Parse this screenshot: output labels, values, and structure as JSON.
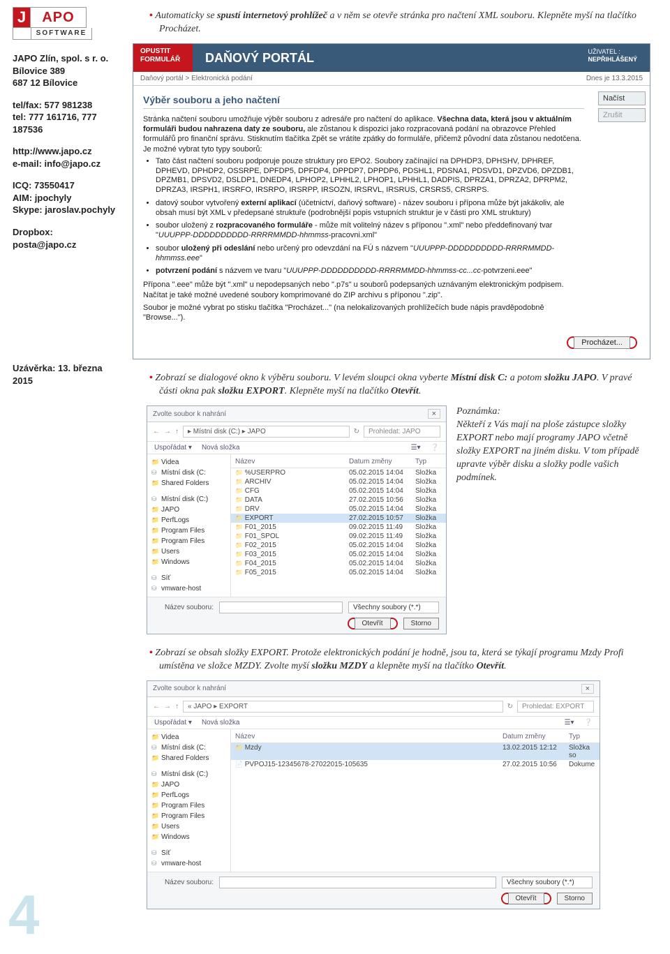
{
  "sidebar": {
    "company": "JAPO Zlín, spol. s r. o.",
    "address1": "Bílovice 389",
    "address2": "687 12 Bílovice",
    "telfax": "tel/fax: 577 981238",
    "tel": "tel: 777 161716, 777 187536",
    "web": "http://www.japo.cz",
    "email": "e-mail: info@japo.cz",
    "icq": "ICQ: 73550417",
    "aim": "AIM: jpochyly",
    "skype": "Skype: jaroslav.pochyly",
    "dropbox": "Dropbox: posta@japo.cz",
    "closing": "Uzávěrka: 13. března 2015"
  },
  "bullets": {
    "b1a": "Automaticky se ",
    "b1b": "spustí internetový prohlížeč",
    "b1c": " a v něm se otevře stránka pro načtení XML souboru. Klepněte myší na tlačítko Procházet.",
    "b2a": "Zobrazí se dialogové okno k výběru souboru. V levém sloupci okna vyberte ",
    "b2b": "Místní disk C:",
    "b2c": " a potom ",
    "b2d": "složku JAPO",
    "b2e": ". V pravé části okna pak ",
    "b2f": "složku EXPORT",
    "b2g": ". Klepněte myší na tlačítko ",
    "b2h": "Otevřít",
    "b2i": ".",
    "b3a": "Zobrazí se obsah složky EXPORT. Protože elektronických podání je hodně, jsou ta, která se týkají programu Mzdy Profi umístěna ve složce MZDY. Zvolte myší ",
    "b3b": "složku MZDY",
    "b3c": " a klepněte myší na tlačítko ",
    "b3d": "Otevřít",
    "b3e": "."
  },
  "note": {
    "title": "Poznámka:",
    "body": "Někteří z Vás mají na ploše zástupce složky EXPORT nebo mají programy JAPO včetně složky EXPORT na jiném disku. V tom případě upravte výběr disku a složky podle vašich podmínek."
  },
  "portal": {
    "opustit1": "OPUSTIT",
    "opustit2": "FORMULÁŘ",
    "title": "DAŇOVÝ PORTÁL",
    "uz1": "UŽIVATEL :",
    "uz2": "NEPŘIHLÁŠENÝ",
    "bc": "Daňový portál > Elektronická podání",
    "date": "Dnes je 13.3.2015",
    "nacist": "Načíst",
    "zrusit": "Zrušit",
    "section": "Výběr souboru a jeho načtení",
    "p1a": "Stránka načtení souboru umožňuje výběr souboru z adresáře pro načtení do aplikace. ",
    "p1b": "Všechna data, která jsou v aktuálním formuláři budou nahrazena daty ze souboru,",
    "p1c": " ale zůstanou k dispozici jako rozpracovaná podání na obrazovce Přehled formulářů pro finanční správu. Stisknutím tlačítka Zpět se vrátíte zpátky do formuláře, přičemž původní data zůstanou nedotčena. Je možné vybrat tyto typy souborů:",
    "li1": "Tato část načtení souboru podporuje pouze struktury pro EPO2. Soubory začínající na DPHDP3, DPHSHV, DPHREF, DPHEVD, DPHDP2, OSSRPE, DPFDP5, DPFDP4, DPPDP7, DPPDP6, PDSHL1, PDSNA1, PDSVD1, DPZVD6, DPZDB1, DPZMB1, DPSVD2, DSLDP1, DNEDP4, LPHOP2, LPHHL2, LPHOP1, LPHHL1, DADPIS, DPRZA1, DPRZA2, DPRPM2, DPRZA3, IRSPH1, IRSRFO, IRSRPO, IRSRPP, IRSOZN, IRSRVL, IRSRUS, CRSRS5, CRSRPS.",
    "li2a": "datový soubor vytvořený ",
    "li2b": "externí aplikací",
    "li2c": " (účetnictví, daňový software) - název souboru i přípona může být jakákoliv, ale obsah musí být XML v předepsané struktuře (podrobnější popis vstupních struktur je v části pro XML struktury)",
    "li3a": "soubor uložený z ",
    "li3b": "rozpracovaného formuláře",
    "li3c": " - může mít volitelný název s příponou \".xml\" nebo předdefinovaný tvar \"",
    "li3d": "UUUPPP-DDDDDDDDDD-RRRRMMDD-hhmmss",
    "li3e": "-pracovni.xml\"",
    "li4a": "soubor ",
    "li4b": "uložený při odeslání",
    "li4c": " nebo určený pro odevzdání na FÚ s názvem \"",
    "li4d": "UUUPPP-DDDDDDDDDD-RRRRMMDD-hhmmss.eee",
    "li4e": "\"",
    "li5a": "potvrzení podání",
    "li5b": " s názvem ve tvaru \"",
    "li5c": "UUUPPP-DDDDDDDDDD-RRRRMMDD-hhmmss-cc...cc",
    "li5d": "-potvrzeni.eee\"",
    "p2": "Přípona \".eee\" může být \".xml\" u nepodepsaných nebo \".p7s\" u souborů podepsaných uznávaným elektronickým podpisem. Načítat je také možné uvedené soubory komprimované do ZIP archivu s příponou \".zip\".",
    "p3": "Soubor je možné vybrat po stisku tlačítka \"Procházet...\" (na nelokalizovaných prohlížečích bude nápis pravděpodobně \"Browse...\").",
    "browse": "Procházet..."
  },
  "dlg1": {
    "title": "Zvolte soubor k nahrání",
    "path": "▸ Místní disk (C:) ▸ JAPO",
    "search": "Prohledat: JAPO",
    "organize": "Uspořádat ▾",
    "newfolder": "Nová složka",
    "side": [
      "Videa",
      "Místní disk (C:",
      "Shared Folders",
      "",
      "Místní disk (C:)",
      "JAPO",
      "PerfLogs",
      "Program Files",
      "Program Files",
      "Users",
      "Windows",
      "",
      "Síť",
      "vmware-host"
    ],
    "head_name": "Název",
    "head_date": "Datum změny",
    "head_type": "Typ",
    "rows": [
      {
        "name": "%USERPRO",
        "date": "05.02.2015 14:04",
        "type": "Složka"
      },
      {
        "name": "ARCHIV",
        "date": "05.02.2015 14:04",
        "type": "Složka"
      },
      {
        "name": "CFG",
        "date": "05.02.2015 14:04",
        "type": "Složka"
      },
      {
        "name": "DATA",
        "date": "27.02.2015 10:56",
        "type": "Složka"
      },
      {
        "name": "DRV",
        "date": "05.02.2015 14:04",
        "type": "Složka"
      },
      {
        "name": "EXPORT",
        "date": "27.02.2015 10:57",
        "type": "Složka",
        "sel": true
      },
      {
        "name": "F01_2015",
        "date": "09.02.2015 11:49",
        "type": "Složka"
      },
      {
        "name": "F01_SPOL",
        "date": "09.02.2015 11:49",
        "type": "Složka"
      },
      {
        "name": "F02_2015",
        "date": "05.02.2015 14:04",
        "type": "Složka"
      },
      {
        "name": "F03_2015",
        "date": "05.02.2015 14:04",
        "type": "Složka"
      },
      {
        "name": "F04_2015",
        "date": "05.02.2015 14:04",
        "type": "Složka"
      },
      {
        "name": "F05_2015",
        "date": "05.02.2015 14:04",
        "type": "Složka"
      }
    ],
    "fname_lbl": "Název souboru:",
    "filter": "Všechny soubory (*.*)",
    "open": "Otevřít",
    "cancel": "Storno"
  },
  "dlg2": {
    "title": "Zvolte soubor k nahrání",
    "path": "« JAPO ▸ EXPORT",
    "search": "Prohledat: EXPORT",
    "organize": "Uspořádat ▾",
    "newfolder": "Nová složka",
    "side": [
      "Videa",
      "Místní disk (C:",
      "Shared Folders",
      "",
      "Místní disk (C:)",
      "JAPO",
      "PerfLogs",
      "Program Files",
      "Program Files",
      "Users",
      "Windows",
      "",
      "Síť",
      "vmware-host"
    ],
    "head_name": "Název",
    "head_date": "Datum změny",
    "head_type": "Typ",
    "rows": [
      {
        "name": "Mzdy",
        "date": "13.02.2015 12:12",
        "type": "Složka so",
        "sel": true
      },
      {
        "name": "PVPOJ15-12345678-27022015-105635",
        "date": "27.02.2015 10:56",
        "type": "Dokume",
        "file": true
      }
    ],
    "fname_lbl": "Název souboru:",
    "filter": "Všechny soubory (*.*)",
    "open": "Otevřít",
    "cancel": "Storno"
  },
  "pagenum": "4"
}
